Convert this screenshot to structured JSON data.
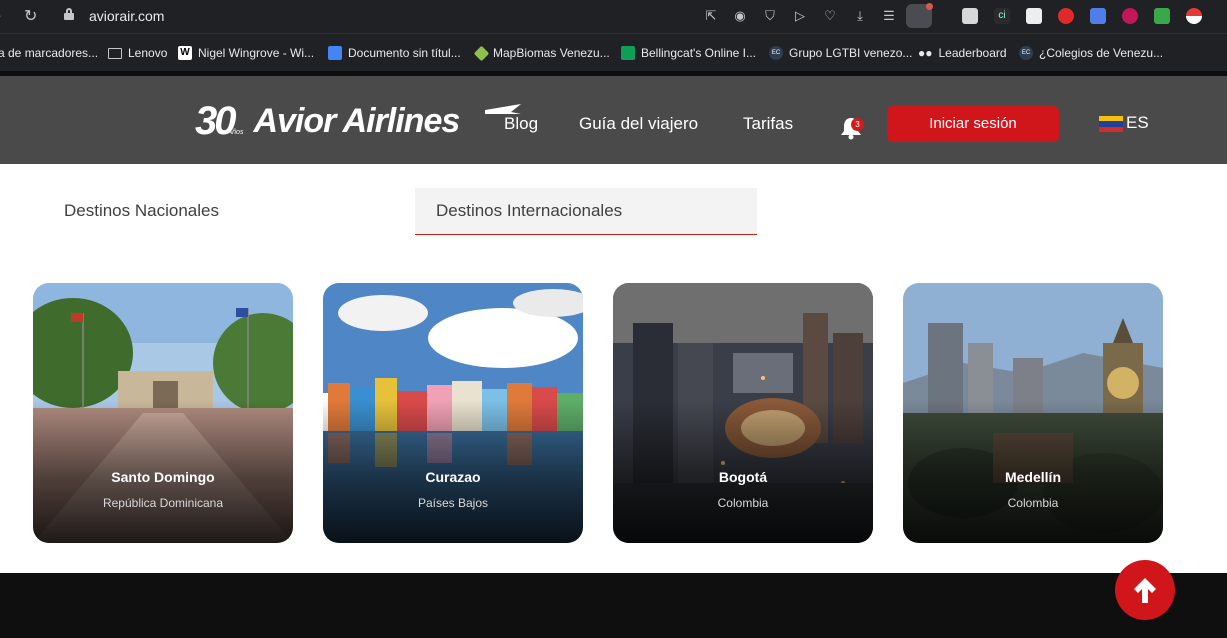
{
  "browser": {
    "url": "aviorair.com",
    "bookmarks": [
      {
        "label": "a de marcadores...",
        "icon": "folder-icon"
      },
      {
        "label": "Lenovo",
        "icon": "folder-icon"
      },
      {
        "label": "Nigel Wingrove - Wi...",
        "icon": "wikipedia-icon"
      },
      {
        "label": "Documento sin títul...",
        "icon": "docs-icon"
      },
      {
        "label": "MapBiomas Venezu...",
        "icon": "mapbiomas-icon"
      },
      {
        "label": "Bellingcat's Online I...",
        "icon": "sheets-icon"
      },
      {
        "label": "Grupo LGTBI venezo...",
        "icon": "ec-icon"
      },
      {
        "label": "Leaderboard",
        "icon": "eyes-icon"
      },
      {
        "label": "¿Colegios de Venezu...",
        "icon": "ec-icon"
      }
    ]
  },
  "header": {
    "logo_30": "30",
    "logo_anos": "Años",
    "logo_name": "Avior Airlines",
    "nav": {
      "blog": "Blog",
      "guide": "Guía del viajero",
      "fares": "Tarifas"
    },
    "notification_count": "3",
    "login_label": "Iniciar sesión",
    "language": "ES"
  },
  "tabs": {
    "national": "Destinos Nacionales",
    "international": "Destinos Internacionales",
    "active": "international"
  },
  "destinations": [
    {
      "city": "Santo Domingo",
      "country": "República Dominicana"
    },
    {
      "city": "Curazao",
      "country": "Países Bajos"
    },
    {
      "city": "Bogotá",
      "country": "Colombia"
    },
    {
      "city": "Medellín",
      "country": "Colombia"
    }
  ],
  "colors": {
    "brand_red": "#d0161b",
    "header_bg": "#4a4a4a",
    "tab_underline": "#c2230f"
  }
}
